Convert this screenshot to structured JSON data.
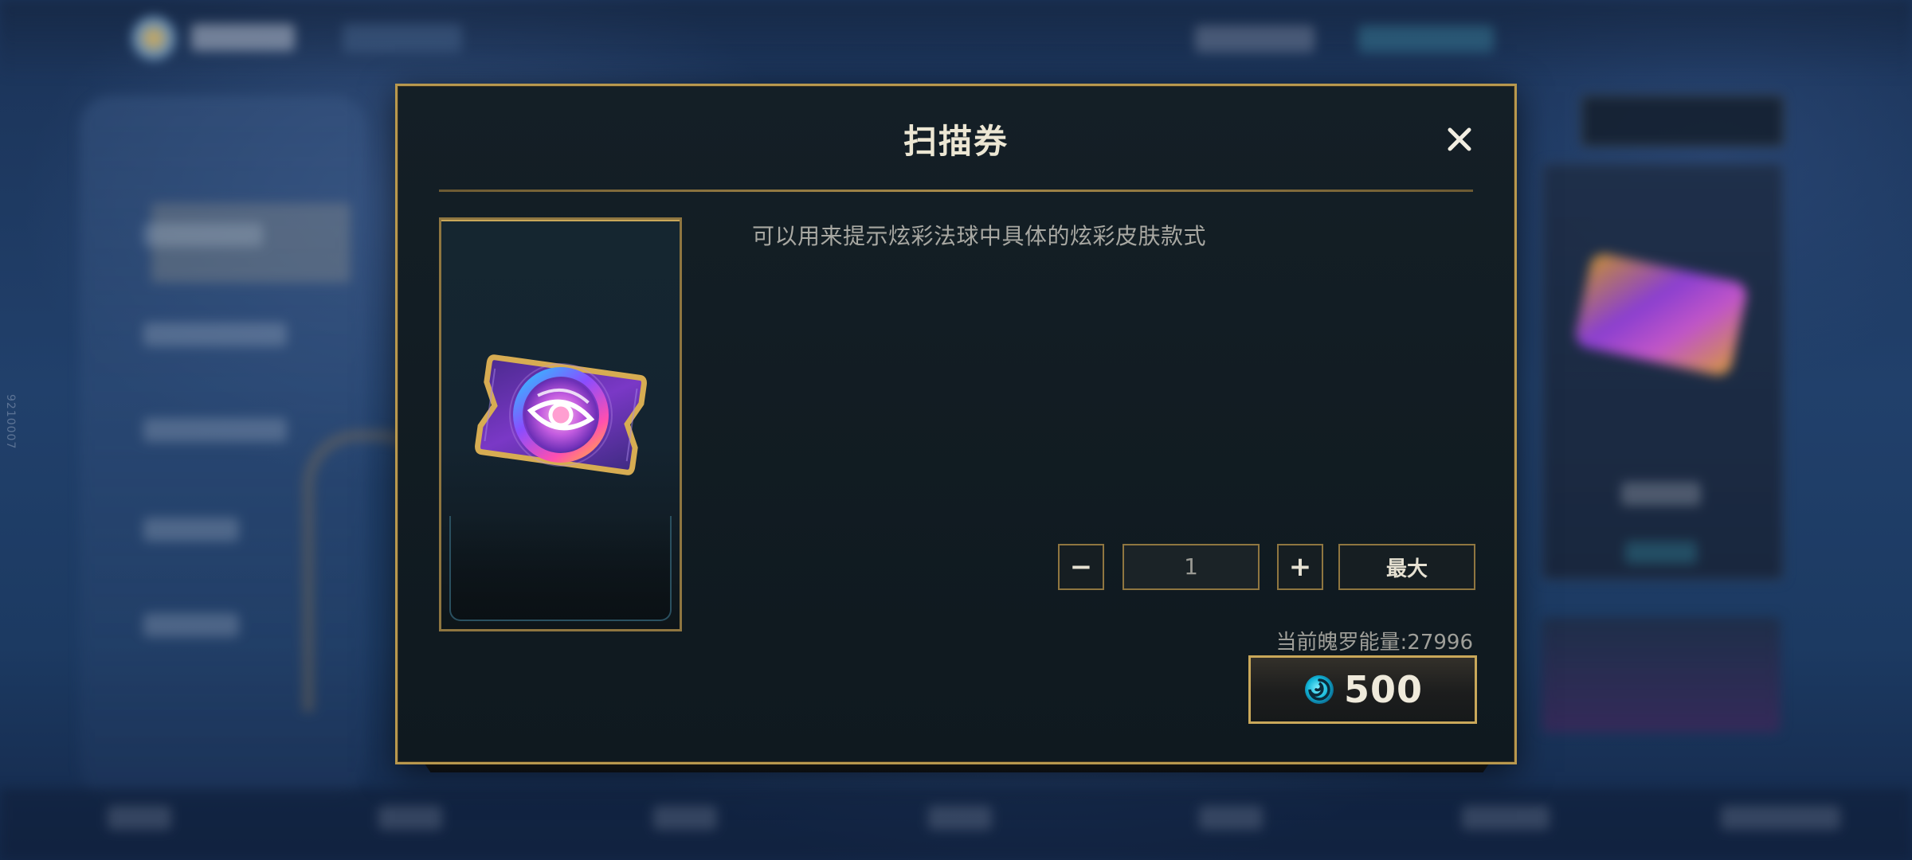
{
  "dialog": {
    "title": "扫描券",
    "description": "可以用来提示炫彩法球中具体的炫彩皮肤款式",
    "item_icon": "scan-ticket-eye-icon",
    "quantity": {
      "minus_label": "−",
      "value": "1",
      "plus_label": "+",
      "max_label": "最大"
    },
    "energy_text": "当前魄罗能量:27996",
    "purchase": {
      "price": "500",
      "currency_icon": "poro-energy-orb-icon"
    },
    "close_icon": "close-icon"
  },
  "background": {
    "vertical_text": "9210007"
  },
  "colors": {
    "gold_border": "#b8984e",
    "dialog_bg": "#141f26",
    "title_text": "#ece6d3",
    "energy_cyan": "#1ec8e0"
  }
}
